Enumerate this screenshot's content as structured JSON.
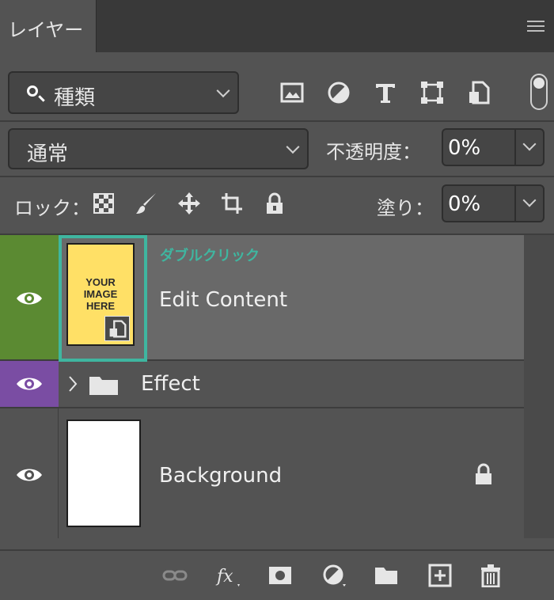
{
  "tabs": [
    {
      "label": "レイヤー"
    }
  ],
  "filter": {
    "label": "種類"
  },
  "filter_icons": [
    "image-filter-icon",
    "adjustment-filter-icon",
    "type-filter-icon",
    "shape-filter-icon",
    "smart-object-filter-icon"
  ],
  "blend_mode": {
    "value": "通常"
  },
  "opacity": {
    "label": "不透明度：",
    "value": "0%"
  },
  "lock": {
    "label": "ロック："
  },
  "fill": {
    "label": "塗り：",
    "value": "0%"
  },
  "layers": [
    {
      "name": "Edit Content",
      "eye_color": "#5b8a32",
      "thumbnail_text": [
        "YOUR",
        "IMAGE",
        "HERE"
      ]
    },
    {
      "name": "Effect",
      "eye_color": "#7a4da3"
    },
    {
      "name": "Background"
    }
  ],
  "annotation": "ダブルクリック",
  "colors": {
    "highlight": "#3fb6a0",
    "panel_bg": "#535353",
    "selected_layer": "#696969"
  }
}
